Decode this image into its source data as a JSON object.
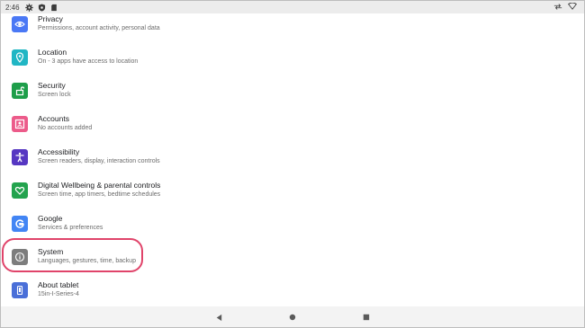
{
  "status_bar": {
    "time": "2:46"
  },
  "settings": [
    {
      "title": "Privacy",
      "subtitle": "Permissions, account activity, personal data",
      "icon": "eye-icon",
      "color": "#4a78f5"
    },
    {
      "title": "Location",
      "subtitle": "On - 3 apps have access to location",
      "icon": "location-pin-icon",
      "color": "#21b6c4"
    },
    {
      "title": "Security",
      "subtitle": "Screen lock",
      "icon": "lock-open-icon",
      "color": "#1e9e4a"
    },
    {
      "title": "Accounts",
      "subtitle": "No accounts added",
      "icon": "account-box-icon",
      "color": "#ec5b8a"
    },
    {
      "title": "Accessibility",
      "subtitle": "Screen readers, display, interaction controls",
      "icon": "accessibility-person-icon",
      "color": "#5637c2"
    },
    {
      "title": "Digital Wellbeing & parental controls",
      "subtitle": "Screen time, app timers, bedtime schedules",
      "icon": "wellbeing-heart-icon",
      "color": "#23a34e"
    },
    {
      "title": "Google",
      "subtitle": "Services & preferences",
      "icon": "google-g-icon",
      "color": "#4285f4"
    },
    {
      "title": "System",
      "subtitle": "Languages, gestures, time, backup",
      "icon": "info-icon",
      "color": "#7d7d7d"
    },
    {
      "title": "About tablet",
      "subtitle": "15in-I-Series-4",
      "icon": "tablet-icon",
      "color": "#4a6fd8"
    }
  ],
  "highlight_color": "#e0446a"
}
